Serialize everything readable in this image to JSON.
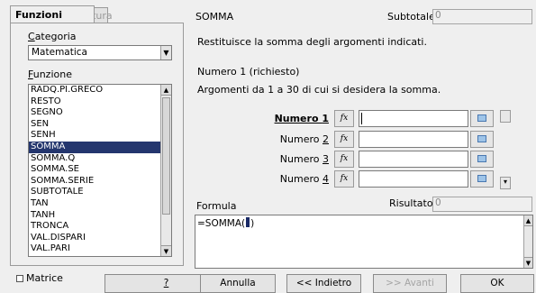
{
  "tabs": {
    "functions": "Funzioni",
    "structure": "Struttura"
  },
  "category": {
    "label": "Categoria",
    "selected": "Matematica"
  },
  "function_list": {
    "label": "Funzione",
    "items": [
      "RADQ.PI.GRECO",
      "RESTO",
      "SEGNO",
      "SEN",
      "SENH",
      "SOMMA",
      "SOMMA.Q",
      "SOMMA.SE",
      "SOMMA.SERIE",
      "SUBTOTALE",
      "TAN",
      "TANH",
      "TRONCA",
      "VAL.DISPARI",
      "VAL.PARI"
    ],
    "selected": "SOMMA"
  },
  "function_info": {
    "name": "SOMMA",
    "subtotal_label": "Subtotale",
    "subtotal_value": "0",
    "description": "Restituisce la somma degli argomenti indicati.",
    "arg_title": "Numero 1 (richiesto)",
    "arg_description": "Argomenti da 1 a 30 di cui si desidera la somma."
  },
  "arguments": [
    {
      "label": "Numero 1",
      "value": "",
      "fx": "fx"
    },
    {
      "label": "Numero 2",
      "value": "",
      "fx": "fx"
    },
    {
      "label": "Numero 3",
      "value": "",
      "fx": "fx"
    },
    {
      "label": "Numero 4",
      "value": "",
      "fx": "fx"
    }
  ],
  "formula": {
    "label": "Formula",
    "value": "=SOMMA(",
    "closing": ")"
  },
  "result": {
    "label": "Risultato",
    "value": "0"
  },
  "matrix": {
    "label": "Matrice",
    "checked": false
  },
  "buttons": {
    "help": "?",
    "cancel": "Annulla",
    "back": "<< Indietro",
    "forward": ">> Avanti",
    "ok": "OK"
  },
  "icons": {
    "dropdown": "chevron-down-icon",
    "scroll_up": "arrow-up-icon",
    "scroll_down": "arrow-down-icon"
  }
}
